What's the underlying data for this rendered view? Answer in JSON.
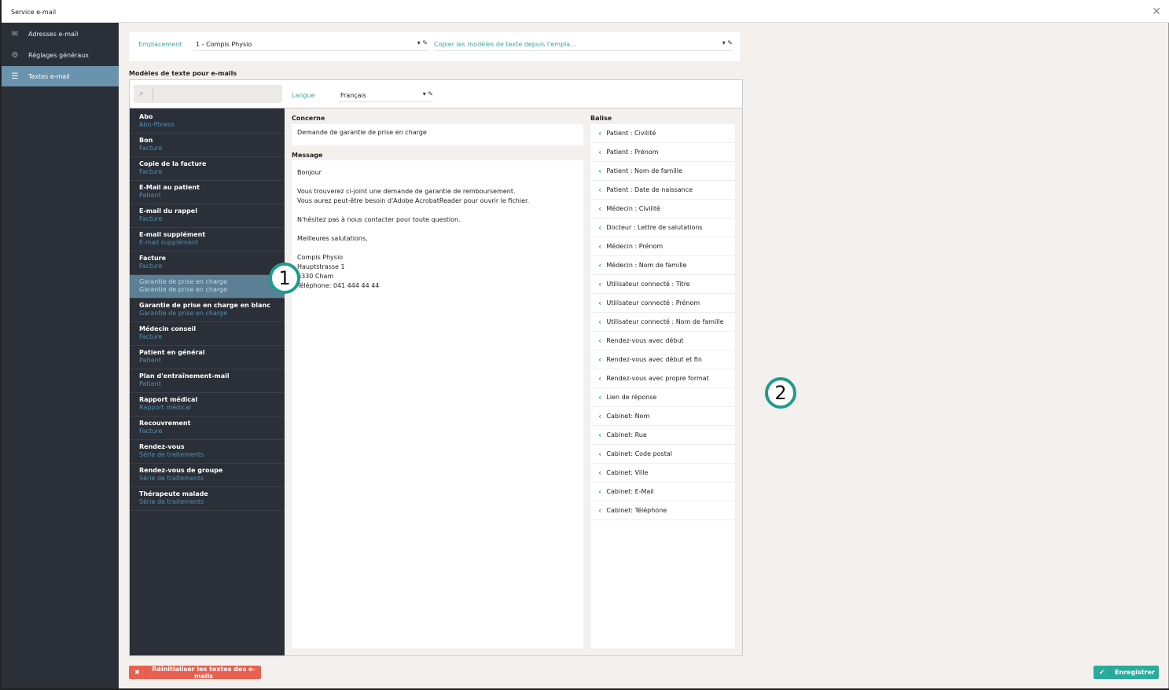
{
  "window": {
    "title": "Service e-mail",
    "close_icon": "close-icon"
  },
  "sidebar": {
    "items": [
      {
        "label": "Adresses e-mail",
        "icon": "envelope-icon"
      },
      {
        "label": "Réglages généraux",
        "icon": "gear-icon"
      },
      {
        "label": "Textes e-mail",
        "icon": "list-icon",
        "selected": true
      }
    ]
  },
  "location": {
    "label": "Emplacement",
    "value": "1 - Compis Physio",
    "copy_placeholder": "Copier les modèles de texte depuis l'empla..."
  },
  "templates": {
    "title": "Modèles de texte pour e-mails",
    "search_placeholder": "",
    "language_label": "Langue",
    "language_value": "Français",
    "items": [
      {
        "name": "Abo",
        "category": "Abo-fitness"
      },
      {
        "name": "Bon",
        "category": "Facture"
      },
      {
        "name": "Copie de la facture",
        "category": "Facture"
      },
      {
        "name": "E-Mail au patient",
        "category": "Patient"
      },
      {
        "name": "E-mail du rappel",
        "category": "Facture"
      },
      {
        "name": "E-mail supplément",
        "category": "E-mail supplément"
      },
      {
        "name": "Facture",
        "category": "Facture"
      },
      {
        "name": "Garantie de prise en charge",
        "category": "Garantie de prise en charge",
        "selected": true
      },
      {
        "name": "Garantie de prise en charge en blanc",
        "category": "Garantie de prise en charge"
      },
      {
        "name": "Médecin conseil",
        "category": "Facture"
      },
      {
        "name": "Patient en général",
        "category": "Patient"
      },
      {
        "name": "Plan d'entraînement-mail",
        "category": "Patient"
      },
      {
        "name": "Rapport médical",
        "category": "Rapport médical"
      },
      {
        "name": "Recouvrement",
        "category": "Facture"
      },
      {
        "name": "Rendez-vous",
        "category": "Série de traitements"
      },
      {
        "name": "Rendez-vous de groupe",
        "category": "Série de traitements"
      },
      {
        "name": "Thérapeute malade",
        "category": "Série de traitements"
      }
    ]
  },
  "editor": {
    "subject_label": "Concerne",
    "subject": "Demande de garantie de prise en charge",
    "message_label": "Message",
    "message_lines": [
      "Bonjour",
      "",
      "Vous trouverez ci-joint une demande de garantie de remboursement.",
      "Vous aurez peut-être besoin d'Adobe AcrobatReader pour ouvrir le fichier.",
      "",
      "N'hésitez pas à nous contacter pour toute question.",
      "",
      "Meilleures salutations,",
      "",
      "Compis Physio",
      "Hauptstrasse 1",
      "6330 Cham",
      "Téléphone: 041 444 44 44"
    ]
  },
  "tags": {
    "label": "Balise",
    "items": [
      "Patient : Civilité",
      "Patient : Prénom",
      "Patient : Nom de famille",
      "Patient : Date de naissance",
      "Médecin : Civilité",
      "Docteur : Lettre de salutations",
      "Médecin : Prénom",
      "Médecin : Nom de famille",
      "Utilisateur connecté : Titre",
      "Utilisateur connecté : Prénom",
      "Utilisateur connecté : Nom de famille",
      "Rendez-vous avec début",
      "Rendez-vous avec début et fin",
      "Rendez-vous avec propre format",
      "Lien de réponse",
      "Cabinet: Nom",
      "Cabinet: Rue",
      "Cabinet: Code postal",
      "Cabinet: Ville",
      "Cabinet: E-Mail",
      "Cabinet: Téléphone"
    ]
  },
  "annotations": [
    "1",
    "2"
  ],
  "buttons": {
    "reset": "Réinitialiser les textes des e-mails",
    "save": "Enregistrer"
  },
  "colors": {
    "accent": "#2bab9c",
    "danger": "#e8604f",
    "sidebar": "#2b3038",
    "selected": "#6a93ad"
  }
}
